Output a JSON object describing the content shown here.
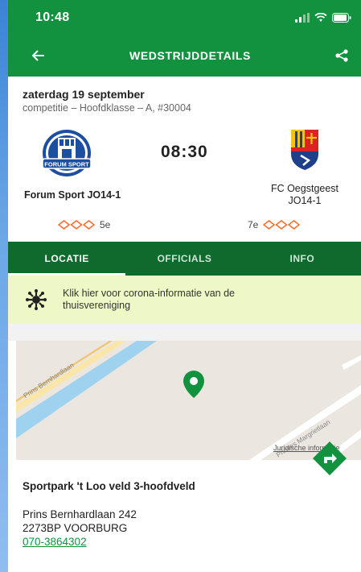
{
  "status_bar": {
    "time": "10:48"
  },
  "header": {
    "title": "WEDSTRIJDDETAILS"
  },
  "match": {
    "date": "zaterdag 19 september",
    "competition": "competitie – Hoofdklasse – A, #30004",
    "kickoff": "08:30",
    "home": {
      "name": "Forum Sport JO14-1",
      "logo_text": "FORUM SPORT",
      "rank": "5e"
    },
    "away": {
      "name_line1": "FC Oegstgeest",
      "name_line2": "JO14-1",
      "rank": "7e"
    }
  },
  "tabs": [
    {
      "label": "LOCATIE",
      "active": true
    },
    {
      "label": "OFFICIALS",
      "active": false
    },
    {
      "label": "INFO",
      "active": false
    }
  ],
  "corona": {
    "text_line1": "Klik hier voor corona-informatie van de",
    "text_line2": "thuisvereniging",
    "icon": "virus-icon"
  },
  "location": {
    "map_labels": {
      "street1": "Prins Bernhardlaan",
      "street2": "Prinses Margrietlaan",
      "legal": "Juridische informatie"
    },
    "venue": "Sportpark 't Loo veld 3-hoofdveld",
    "address_line1": "Prins Bernhardlaan 242",
    "address_line2": "2273BP VOORBURG",
    "phone": "070-3864302"
  },
  "colors": {
    "primary": "#12913f",
    "tabs_bg": "#0e6a2d",
    "rank_diamond": "#ff6a2a",
    "banner_bg": "#eef8c6"
  }
}
